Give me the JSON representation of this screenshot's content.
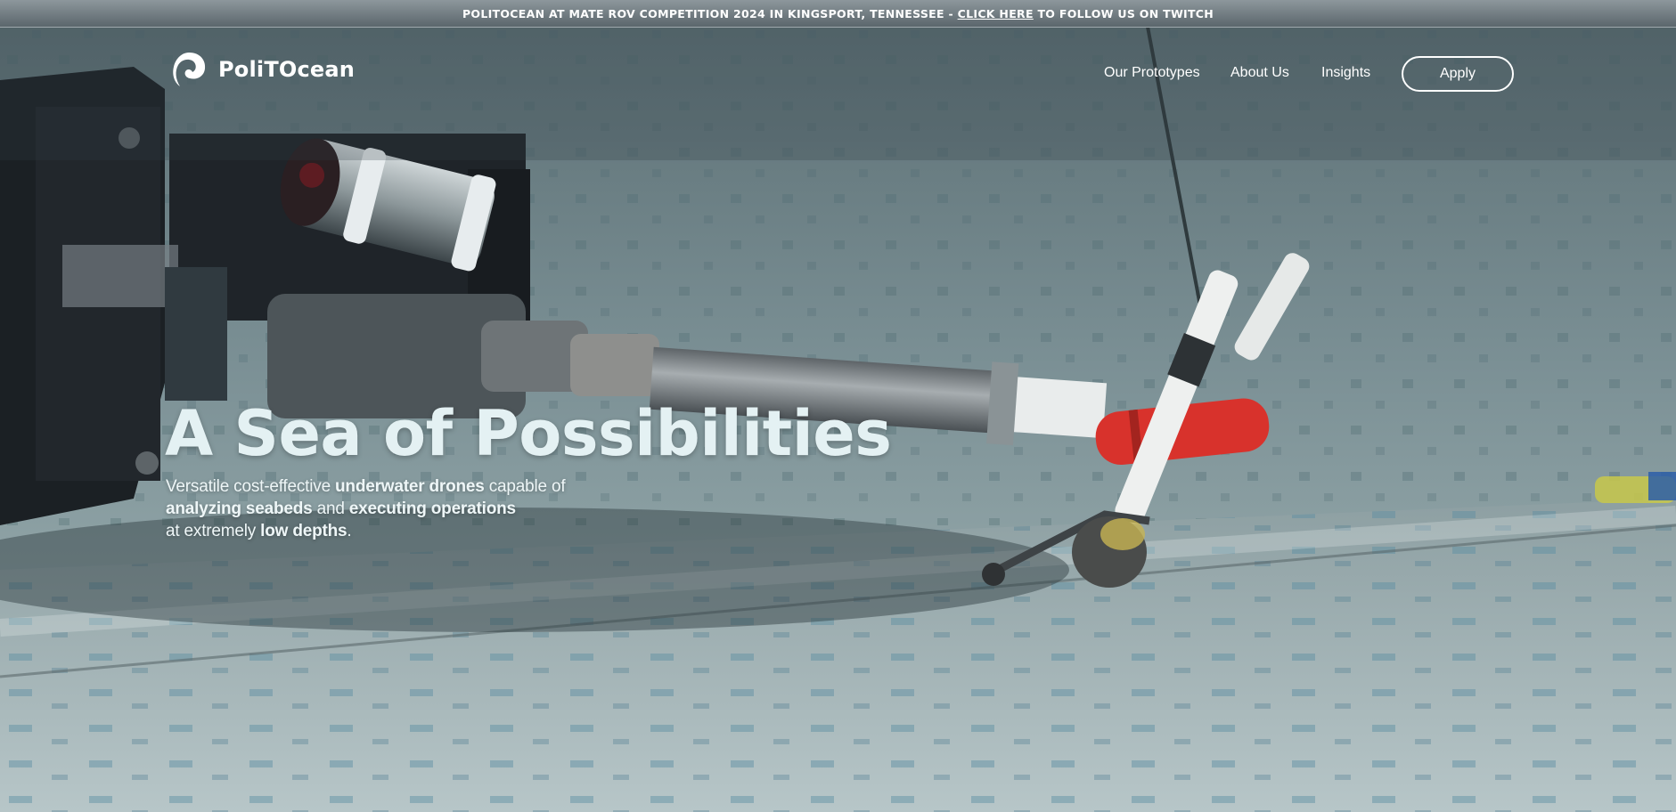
{
  "announcement": {
    "prefix": "POLITOCEAN AT MATE ROV COMPETITION 2024 IN KINGSPORT, TENNESSEE - ",
    "link": "CLICK HERE",
    "suffix": " TO FOLLOW US ON TWITCH"
  },
  "brand": {
    "name": "PoliTOcean",
    "logo_icon": "wave-drop-icon"
  },
  "nav": {
    "items": [
      "Our Prototypes",
      "About Us",
      "Insights"
    ],
    "cta": "Apply"
  },
  "hero": {
    "title": "A Sea of Possibilities",
    "subtitle": [
      [
        "Versatile cost-effective ",
        "underwater drones",
        " capable of"
      ],
      [
        "",
        "analyzing seabeds",
        " and ",
        "executing operations"
      ],
      [
        "at extremely ",
        "low depths",
        "."
      ]
    ]
  },
  "colors": {
    "water": "#6f8388",
    "text_light": "#e4f1f3",
    "buoy_red": "#d8322c"
  }
}
